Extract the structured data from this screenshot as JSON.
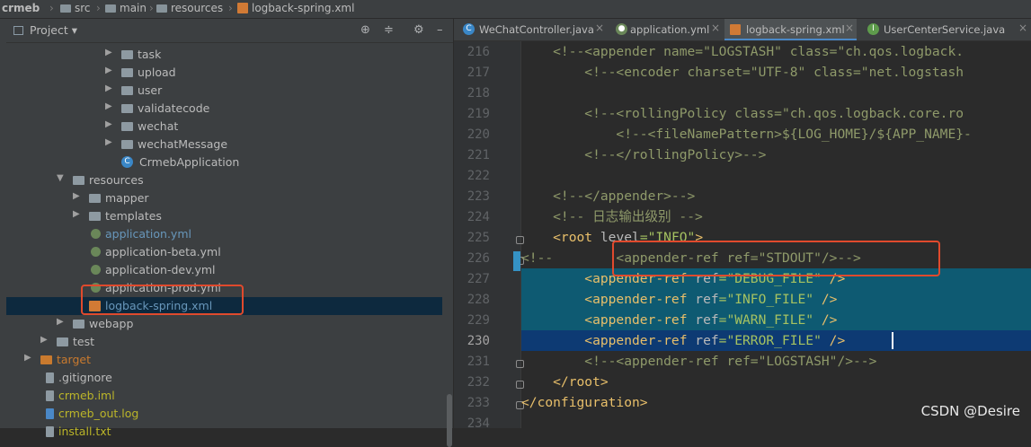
{
  "breadcrumb": [
    "crmeb",
    "src",
    "main",
    "resources",
    "logback-spring.xml"
  ],
  "project_panel": {
    "title": "Project",
    "tree": [
      {
        "label": "task",
        "kind": "folder"
      },
      {
        "label": "upload",
        "kind": "folder"
      },
      {
        "label": "user",
        "kind": "folder"
      },
      {
        "label": "validatecode",
        "kind": "folder"
      },
      {
        "label": "wechat",
        "kind": "folder"
      },
      {
        "label": "wechatMessage",
        "kind": "folder"
      },
      {
        "label": "CrmebApplication",
        "kind": "class"
      },
      {
        "label": "resources",
        "kind": "folder-open"
      },
      {
        "label": "mapper",
        "kind": "folder"
      },
      {
        "label": "templates",
        "kind": "folder"
      },
      {
        "label": "application.yml",
        "kind": "yml"
      },
      {
        "label": "application-beta.yml",
        "kind": "yml"
      },
      {
        "label": "application-dev.yml",
        "kind": "yml"
      },
      {
        "label": "application-prod.yml",
        "kind": "yml"
      },
      {
        "label": "logback-spring.xml",
        "kind": "xml"
      },
      {
        "label": "webapp",
        "kind": "folder"
      },
      {
        "label": "test",
        "kind": "folder"
      },
      {
        "label": "target",
        "kind": "folder-target"
      },
      {
        "label": ".gitignore",
        "kind": "file"
      },
      {
        "label": "crmeb.iml",
        "kind": "file"
      },
      {
        "label": "crmeb_out.log",
        "kind": "log"
      },
      {
        "label": "install.txt",
        "kind": "file"
      }
    ]
  },
  "tabs": [
    "WeChatController.java",
    "application.yml",
    "logback-spring.xml",
    "UserCenterService.java"
  ],
  "line_numbers": [
    "216",
    "217",
    "218",
    "219",
    "220",
    "221",
    "222",
    "223",
    "224",
    "225",
    "226",
    "227",
    "228",
    "229",
    "230",
    "231",
    "232",
    "233",
    "234"
  ],
  "code_lines": [
    {
      "t": [
        {
          "c": "cm",
          "s": "    <!--<appender name=\"LOGSTASH\" class=\"ch.qos.logback."
        }
      ]
    },
    {
      "t": [
        {
          "c": "cm",
          "s": "        <!--<encoder charset=\"UTF-8\" class=\"net.logstash"
        }
      ]
    },
    {
      "t": [
        {
          "c": "cm",
          "s": ""
        }
      ]
    },
    {
      "t": [
        {
          "c": "cm",
          "s": "        <!--<rollingPolicy class=\"ch.qos.logback.core.ro"
        }
      ]
    },
    {
      "t": [
        {
          "c": "cm",
          "s": "            <!--<fileNamePattern>${LOG_HOME}/${APP_NAME}-"
        }
      ]
    },
    {
      "t": [
        {
          "c": "cm",
          "s": "        <!--</rollingPolicy>-->"
        }
      ]
    },
    {
      "t": [
        {
          "c": "cm",
          "s": ""
        }
      ]
    },
    {
      "t": [
        {
          "c": "cm",
          "s": "    <!--</appender>-->"
        }
      ]
    },
    {
      "t": [
        {
          "c": "cm",
          "s": "    <!-- 日志输出级别 -->"
        }
      ]
    },
    {
      "t": [
        {
          "c": "tg",
          "s": "    <root "
        },
        {
          "c": "at",
          "s": "level"
        },
        {
          "c": "av",
          "s": "=\"INFO\""
        },
        {
          "c": "tg",
          "s": ">"
        }
      ]
    },
    {
      "t": [
        {
          "c": "cm",
          "s": "<!--        <appender-ref ref=\"STDOUT\"/>-->"
        }
      ]
    },
    {
      "t": [
        {
          "c": "tg",
          "s": "        <appender-ref "
        },
        {
          "c": "at",
          "s": "ref"
        },
        {
          "c": "av",
          "s": "=\"DEBUG_FILE\""
        },
        {
          "c": "tg",
          "s": " />"
        }
      ]
    },
    {
      "t": [
        {
          "c": "tg",
          "s": "        <appender-ref "
        },
        {
          "c": "at",
          "s": "ref"
        },
        {
          "c": "av",
          "s": "=\"INFO_FILE\""
        },
        {
          "c": "tg",
          "s": " />"
        }
      ]
    },
    {
      "t": [
        {
          "c": "tg",
          "s": "        <appender-ref "
        },
        {
          "c": "at",
          "s": "ref"
        },
        {
          "c": "av",
          "s": "=\"WARN_FILE\""
        },
        {
          "c": "tg",
          "s": " />"
        }
      ]
    },
    {
      "t": [
        {
          "c": "tg",
          "s": "        <appender-ref "
        },
        {
          "c": "at",
          "s": "ref"
        },
        {
          "c": "av",
          "s": "=\"ERROR_FILE\""
        },
        {
          "c": "tg",
          "s": " />"
        }
      ]
    },
    {
      "t": [
        {
          "c": "cm",
          "s": "        <!--<appender-ref ref=\"LOGSTASH\"/>-->"
        }
      ]
    },
    {
      "t": [
        {
          "c": "tg",
          "s": "    </root>"
        }
      ]
    },
    {
      "t": [
        {
          "c": "tg",
          "s": "</configuration>"
        }
      ]
    },
    {
      "t": [
        {
          "c": "cm",
          "s": ""
        }
      ]
    }
  ],
  "watermark": "CSDN @Desire",
  "colors": {
    "highlight": "#0e5a72",
    "current_line": "#0d3a73",
    "annotation": "#e04a2d"
  }
}
